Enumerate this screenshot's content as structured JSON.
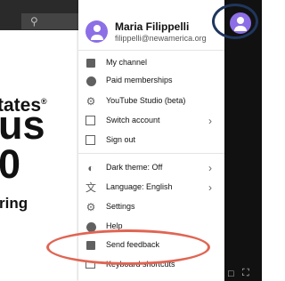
{
  "background": {
    "page_text_lines": [
      "tates",
      "us",
      "0",
      "ring"
    ],
    "trademark": "®"
  },
  "account": {
    "name": "Maria Filippelli",
    "email": "filippelli@newamerica.org"
  },
  "menu": {
    "group1": [
      {
        "label": "My channel",
        "icon": "account-box-icon",
        "has_chevron": false
      },
      {
        "label": "Paid memberships",
        "icon": "dollar-icon",
        "has_chevron": false
      },
      {
        "label": "YouTube Studio (beta)",
        "icon": "gear-icon",
        "has_chevron": false
      },
      {
        "label": "Switch account",
        "icon": "switch-account-icon",
        "has_chevron": true
      },
      {
        "label": "Sign out",
        "icon": "sign-out-icon",
        "has_chevron": false
      }
    ],
    "group2": [
      {
        "label": "Dark theme: Off",
        "icon": "dark-theme-icon",
        "has_chevron": true
      },
      {
        "label": "Language: English",
        "icon": "translate-icon",
        "has_chevron": true
      },
      {
        "label": "Settings",
        "icon": "gear-icon",
        "has_chevron": false
      },
      {
        "label": "Help",
        "icon": "help-icon",
        "has_chevron": false
      },
      {
        "label": "Send feedback",
        "icon": "feedback-icon",
        "has_chevron": false
      },
      {
        "label": "Keyboard shortcuts",
        "icon": "keyboard-icon",
        "has_chevron": false
      }
    ],
    "chevron_glyph": "›"
  },
  "colors": {
    "avatar": "#8c6ee6",
    "annotation_ring": "#20365d",
    "annotation_oval": "#e06553"
  }
}
